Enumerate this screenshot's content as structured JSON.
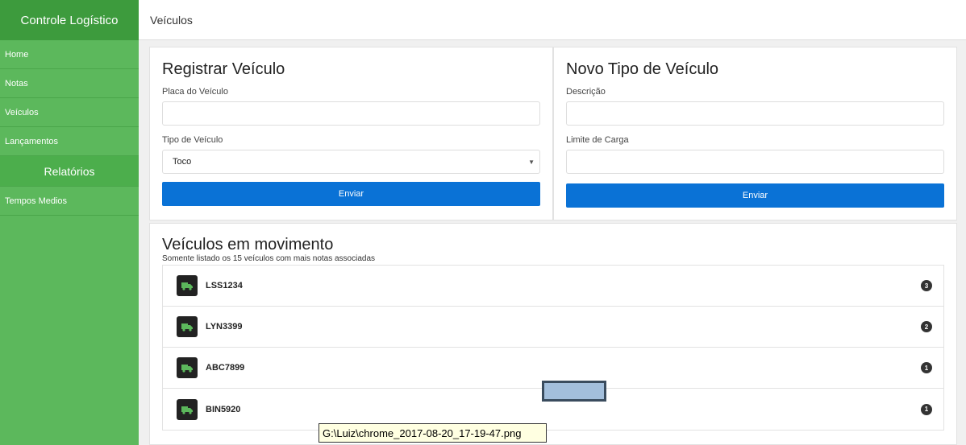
{
  "sidebar": {
    "title": "Controle Logístico",
    "items": [
      {
        "label": "Home"
      },
      {
        "label": "Notas"
      },
      {
        "label": "Veículos"
      },
      {
        "label": "Lançamentos"
      }
    ],
    "section_title": "Relatórios",
    "report_items": [
      {
        "label": "Tempos Medios"
      }
    ]
  },
  "header": {
    "title": "Veículos"
  },
  "register": {
    "title": "Registrar Veículo",
    "plate_label": "Placa do Veículo",
    "plate_value": "",
    "type_label": "Tipo de Veículo",
    "type_value": "Toco",
    "submit": "Enviar"
  },
  "new_type": {
    "title": "Novo Tipo de Veículo",
    "desc_label": "Descrição",
    "desc_value": "",
    "limit_label": "Limite de Carga",
    "limit_value": "",
    "submit": "Enviar"
  },
  "moving": {
    "title": "Veículos em movimento",
    "subtitle": "Somente listado os 15 veículos com mais notas associadas",
    "vehicles": [
      {
        "plate": "LSS1234",
        "count": "3"
      },
      {
        "plate": "LYN3399",
        "count": "2"
      },
      {
        "plate": "ABC7899",
        "count": "1"
      },
      {
        "plate": "BIN5920",
        "count": "1"
      }
    ]
  },
  "tooltip": {
    "text": "G:\\Luiz\\chrome_2017-08-20_17-19-47.png"
  },
  "colors": {
    "sidebar": "#5cb85c",
    "sidebar_header": "#3d9b3d",
    "primary": "#0a72d6",
    "truck_icon": "#5cb85c"
  },
  "icons": {
    "vehicle": "truck-icon",
    "select": "caret-down-icon"
  }
}
